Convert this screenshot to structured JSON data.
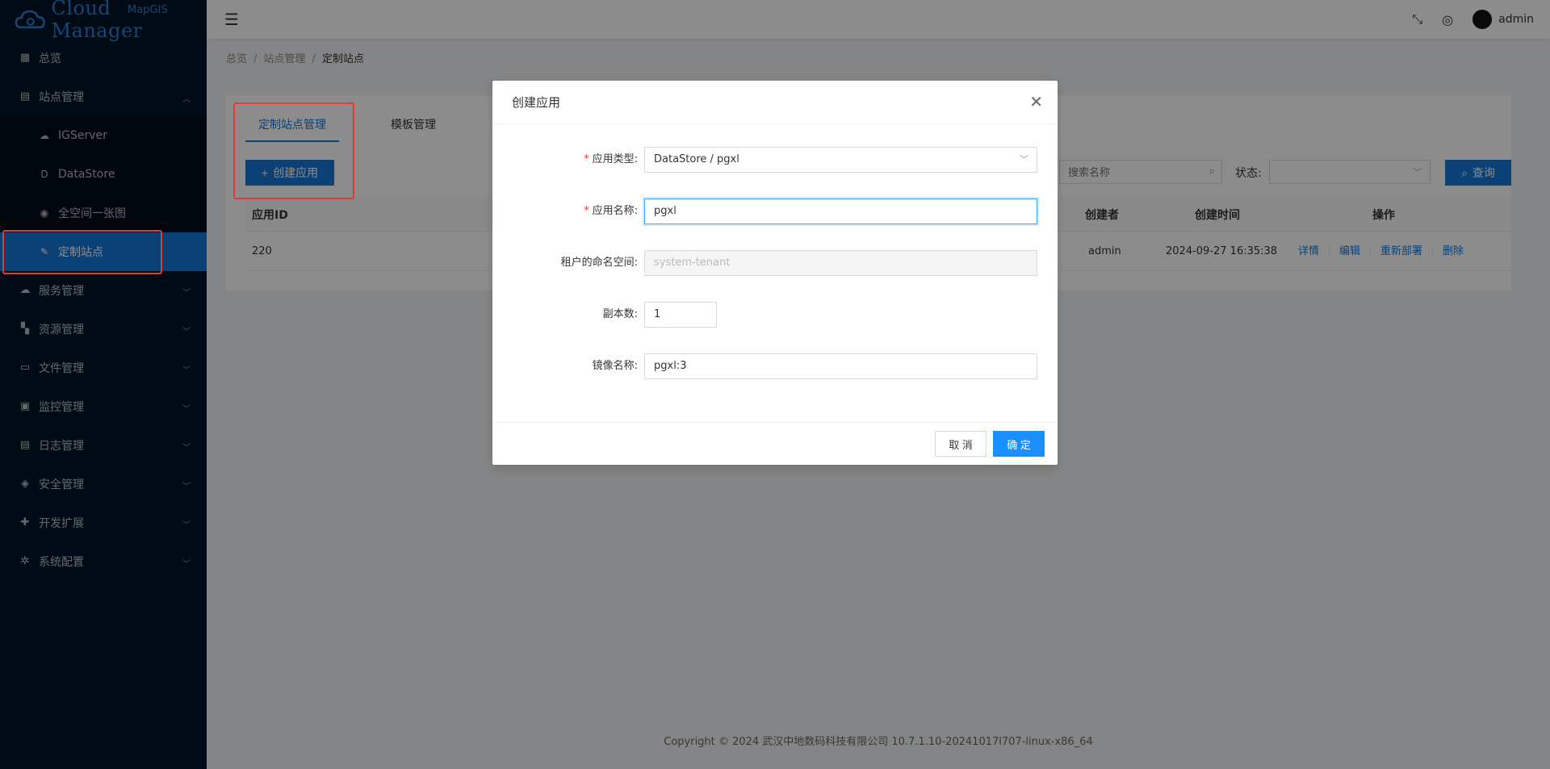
{
  "logo": {
    "brand_sup": "MapGIS",
    "brand_text": "Cloud Manager"
  },
  "sidebar": {
    "items": [
      {
        "label": "总览",
        "icon": "dashboard-icon"
      },
      {
        "label": "站点管理",
        "icon": "site-icon",
        "expanded": true,
        "children": [
          {
            "label": "IGServer",
            "icon": "cloud-icon"
          },
          {
            "label": "DataStore",
            "icon": "datastore-icon"
          },
          {
            "label": "全空间一张图",
            "icon": "eye-icon"
          },
          {
            "label": "定制站点",
            "icon": "edit-icon",
            "active": true
          }
        ]
      },
      {
        "label": "服务管理",
        "icon": "service-icon"
      },
      {
        "label": "资源管理",
        "icon": "resource-icon"
      },
      {
        "label": "文件管理",
        "icon": "folder-icon"
      },
      {
        "label": "监控管理",
        "icon": "monitor-icon"
      },
      {
        "label": "日志管理",
        "icon": "log-icon"
      },
      {
        "label": "安全管理",
        "icon": "shield-icon"
      },
      {
        "label": "开发扩展",
        "icon": "puzzle-icon"
      },
      {
        "label": "系统配置",
        "icon": "gear-icon"
      }
    ]
  },
  "header": {
    "user": "admin"
  },
  "breadcrumb": {
    "items": [
      "总览",
      "站点管理",
      "定制站点"
    ]
  },
  "page": {
    "tabs": [
      "定制站点管理",
      "模板管理"
    ],
    "create_label": "创建应用",
    "search_placeholder": "搜索名称",
    "status_label": "状态:",
    "query_label": "查询",
    "table": {
      "headers": {
        "id": "应用ID",
        "creator": "创建者",
        "created": "创建时间",
        "ops": "操作"
      },
      "rows": [
        {
          "id": "220",
          "creator": "admin",
          "created": "2024-09-27 16:35:38"
        }
      ],
      "actions": [
        "详情",
        "编辑",
        "重新部署",
        "删除"
      ]
    }
  },
  "footer": "Copyright © 2024 武汉中地数码科技有限公司 10.7.1.10-20241017l707-linux-x86_64",
  "modal": {
    "title": "创建应用",
    "fields": {
      "app_type": {
        "label": "应用类型:",
        "value": "DataStore / pgxl"
      },
      "app_name": {
        "label": "应用名称:",
        "value": "pgxl"
      },
      "namespace": {
        "label": "租户的命名空间:",
        "value": "system-tenant"
      },
      "replicas": {
        "label": "副本数:",
        "value": "1"
      },
      "image": {
        "label": "镜像名称:",
        "value": "pgxl:3"
      }
    },
    "cancel_label": "取 消",
    "ok_label": "确 定"
  }
}
